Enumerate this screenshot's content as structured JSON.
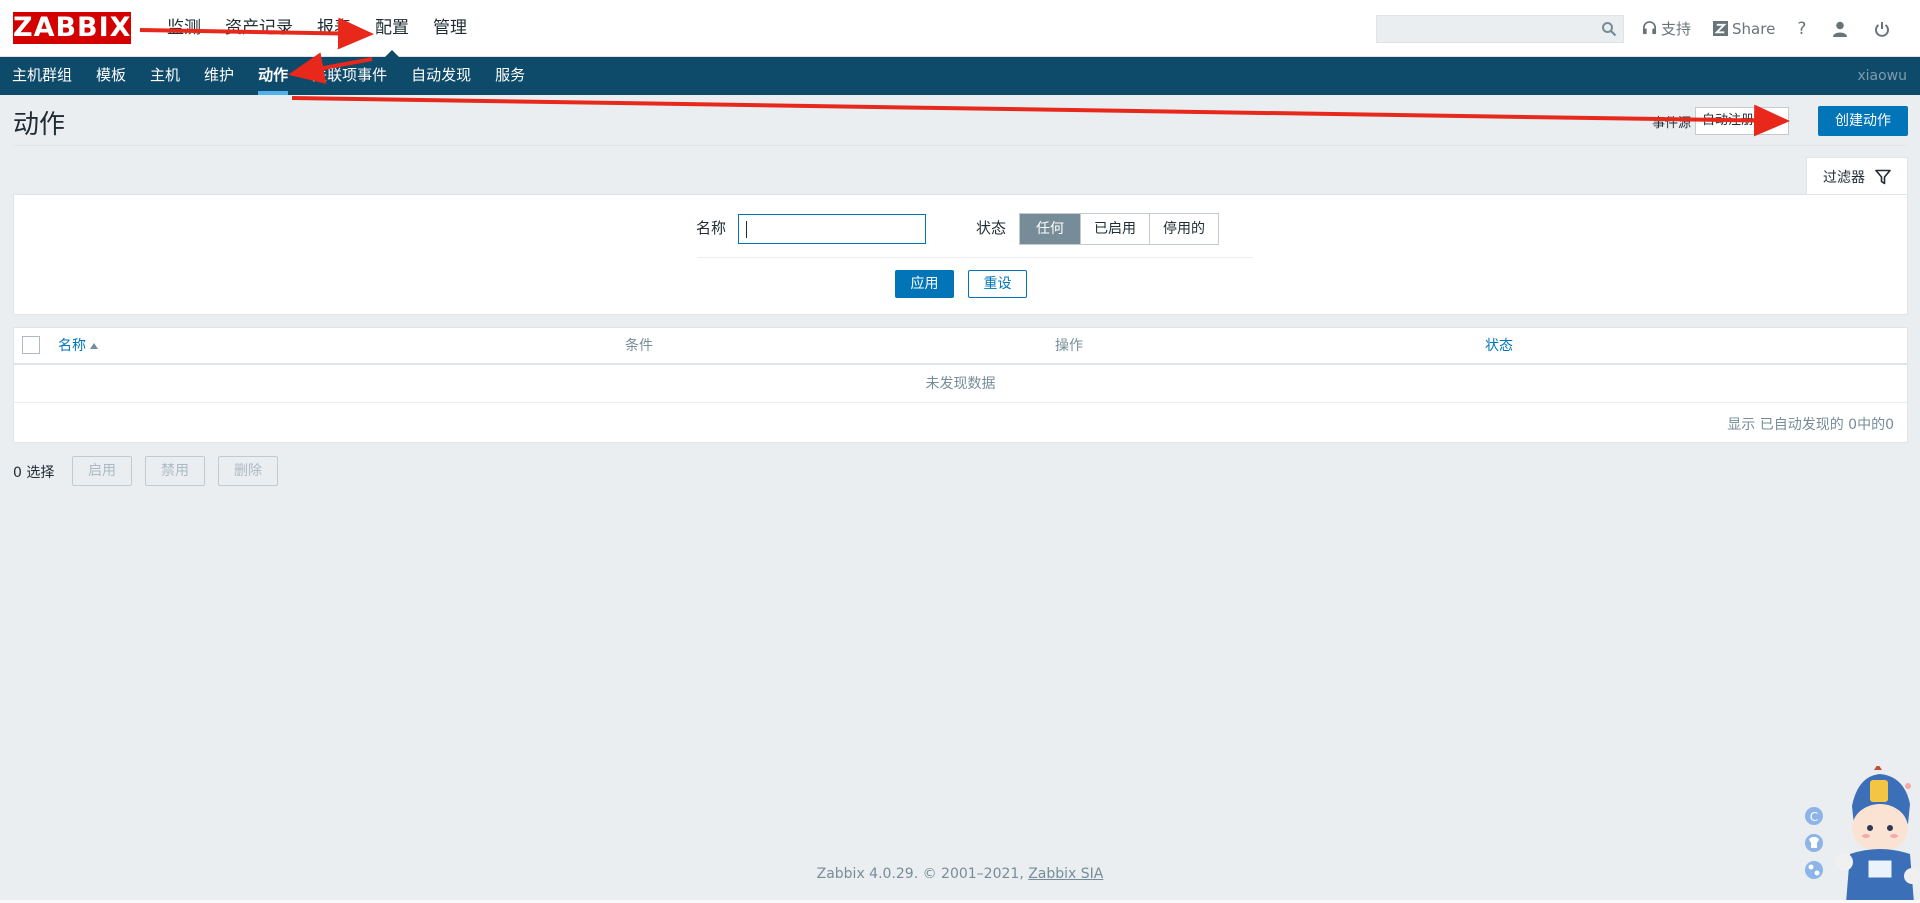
{
  "header": {
    "logo_text": "ZABBIX",
    "main_nav": [
      {
        "label": "监测"
      },
      {
        "label": "资产记录"
      },
      {
        "label": "报表"
      },
      {
        "label": "配置",
        "active": true
      },
      {
        "label": "管理"
      }
    ],
    "search": {
      "placeholder": "",
      "value": ""
    },
    "tools": {
      "support_label": "支持",
      "share_label": "Share",
      "help_label": "?"
    }
  },
  "sub_nav": {
    "items": [
      {
        "label": "主机群组"
      },
      {
        "label": "模板"
      },
      {
        "label": "主机"
      },
      {
        "label": "维护"
      },
      {
        "label": "动作",
        "active": true
      },
      {
        "label": "关联项事件"
      },
      {
        "label": "自动发现"
      },
      {
        "label": "服务"
      }
    ],
    "user": "xiaowu"
  },
  "page": {
    "title": "动作",
    "event_source_label": "事件源",
    "event_source_value": "自动注册",
    "create_button": "创建动作"
  },
  "filter": {
    "tab_label": "过滤器",
    "name_label": "名称",
    "name_value": "",
    "status_label": "状态",
    "status_options": [
      {
        "label": "任何",
        "selected": true
      },
      {
        "label": "已启用"
      },
      {
        "label": "停用的"
      }
    ],
    "apply_button": "应用",
    "reset_button": "重设"
  },
  "table": {
    "columns": [
      {
        "label": "名称",
        "sortable": true,
        "sorted": "asc"
      },
      {
        "label": "条件"
      },
      {
        "label": "操作"
      },
      {
        "label": "状态"
      }
    ],
    "rows": [],
    "empty_text": "未发现数据",
    "paging_text": "显示 已自动发现的 0中的0"
  },
  "mass_actions": {
    "selected_count": "0 选择",
    "enable_button": "启用",
    "disable_button": "禁用",
    "delete_button": "删除"
  },
  "footer": {
    "text": "Zabbix 4.0.29. © 2001–2021, ",
    "link": "Zabbix SIA"
  },
  "colors": {
    "brand_red": "#d40000",
    "subnav_bg": "#0e4a6a",
    "primary_blue": "#0275b8",
    "annotation_red": "#e8281b"
  }
}
